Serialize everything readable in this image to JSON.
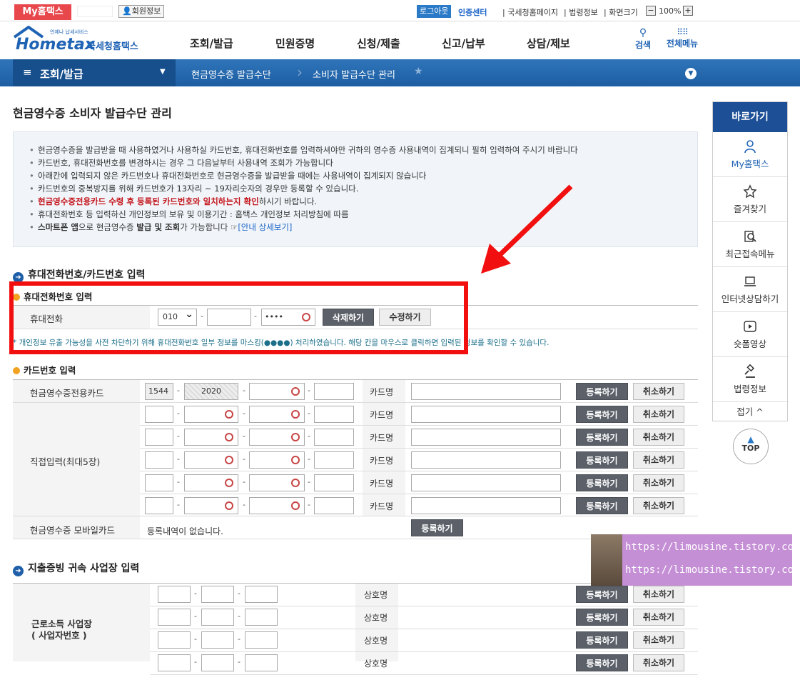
{
  "topbar": {
    "my_tab": "My홈택스",
    "userinfo": "회원정보",
    "logout": "로그아웃",
    "cert": "인증센터",
    "links": [
      "국세청홈페이지",
      "법령정보",
      "화면크기"
    ],
    "zoom": "100%",
    "zoom_minus": "−",
    "zoom_plus": "+"
  },
  "header": {
    "logo_small": "언제나 납세서비스",
    "logo_text": "Hometax",
    "logo_sub": "국세청홈택스",
    "nav": [
      "조회/발급",
      "민원증명",
      "신청/제출",
      "신고/납부",
      "상담/제보"
    ],
    "search": "검색",
    "allmenu": "전체메뉴"
  },
  "breadcrumb": {
    "menu": "조회/발급",
    "items": [
      "현금영수증 발급수단",
      "소비자 발급수단 관리"
    ]
  },
  "page_title": "현금영수증 소비자 발급수단 관리",
  "notice": {
    "items": [
      "현금영수증을 발급받을 때 사용하였거나 사용하실 카드번호, 휴대전화번호를 입력하셔야만 귀하의 영수증 사용내역이 집계되니 필히 입력하여 주시기 바랍니다",
      "카드번호, 휴대전화번호를 변경하시는 경우 그 다음날부터 사용내역 조회가 가능합니다",
      "아래칸에 입력되지 않은 카드번호나 휴대전화번호로 현금영수증을 발급받을 때에는 사용내역이 집계되지 않습니다",
      "카드번호의 중복방지를 위해 카드번호가 13자리 ~ 19자리숫자의 경우만 등록할 수 있습니다."
    ],
    "red_text": "현금영수증전용카드 수령 후 등록된 카드번호와 일치하는지 확인",
    "red_tail": "하시기 바랍니다.",
    "privacy": "휴대전화번호 등 입력하신 개인정보의 보유 및 이용기간 : 홈택스 개인정보 처리방침에 따름",
    "smart_a": "스마트폰 앱",
    "smart_b": "으로 현금영수증 ",
    "smart_c": "발급 및 조회",
    "smart_d": "가 가능합니다 ☞",
    "smart_link": "[안내 상세보기]"
  },
  "section1": {
    "title": "휴대전화번호/카드번호 입력",
    "phone_sub": "휴대전화번호 입력",
    "phone_label": "휴대전화",
    "carrier": "010",
    "phone_mask": "••••",
    "delete": "삭제하기",
    "modify": "수정하기",
    "mask_note": "* 개인정보 유출 가능성을 사전 차단하기 위해 휴대전화번호 일부 정보를 마스킹(●●●●) 처리하였습니다. 해당 칸을 마우스로 클릭하면 입력된 정보를 확인할 수 있습니다.",
    "card_sub": "카드번호 입력",
    "card_label1": "현금영수증전용카드",
    "card_prefix": "1544",
    "card_second": "2020",
    "card_name": "카드명",
    "register": "등록하기",
    "cancel": "취소하기",
    "card_label2": "직접입력(최대5장)",
    "mobile_label": "현금영수증 모바일카드",
    "mobile_none": "등록내역이 없습니다."
  },
  "section2": {
    "title": "지출증빙 귀속 사업장 입력",
    "label_a": "근로소득 사업장",
    "label_b": "( 사업자번호 )",
    "shop_name": "상호명",
    "register": "등록하기",
    "cancel": "취소하기"
  },
  "quick": {
    "head": "바로가기",
    "items": [
      "My홈택스",
      "즐겨찾기",
      "최근접속메뉴",
      "인터넷상담하기",
      "숏폼영상",
      "법령정보"
    ],
    "fold": "접기 ^",
    "top": "TOP"
  },
  "watermark": {
    "url1": "https://limousine.tistory.com/",
    "url2": "https://limousine.tistory.com/"
  }
}
